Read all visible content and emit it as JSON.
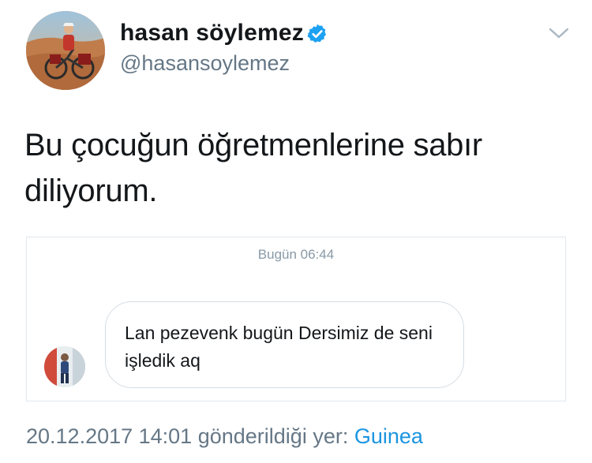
{
  "tweet": {
    "author": {
      "display_name": "hasan söylemez",
      "handle": "@hasansoylemez",
      "verified": true,
      "avatar_icon": "profile-avatar-cyclist"
    },
    "text": "Bu çocuğun öğretmenlerine sabır diliyorum.",
    "menu_icon": "chevron-down-icon",
    "attached_message": {
      "timestamp": "Bugün 06:44",
      "message_text": "Lan pezevenk bugün Dersimiz de seni işledik aq",
      "sender_avatar_icon": "sender-avatar"
    },
    "meta": {
      "date_time": "20.12.2017 14:01",
      "sent_from_label": "gönderildiği yer:",
      "location": "Guinea"
    }
  },
  "colors": {
    "text_primary": "#14171a",
    "text_secondary": "#657786",
    "link_blue": "#1b95e0",
    "verified_blue": "#1da1f2",
    "border": "#e1e8ed"
  }
}
